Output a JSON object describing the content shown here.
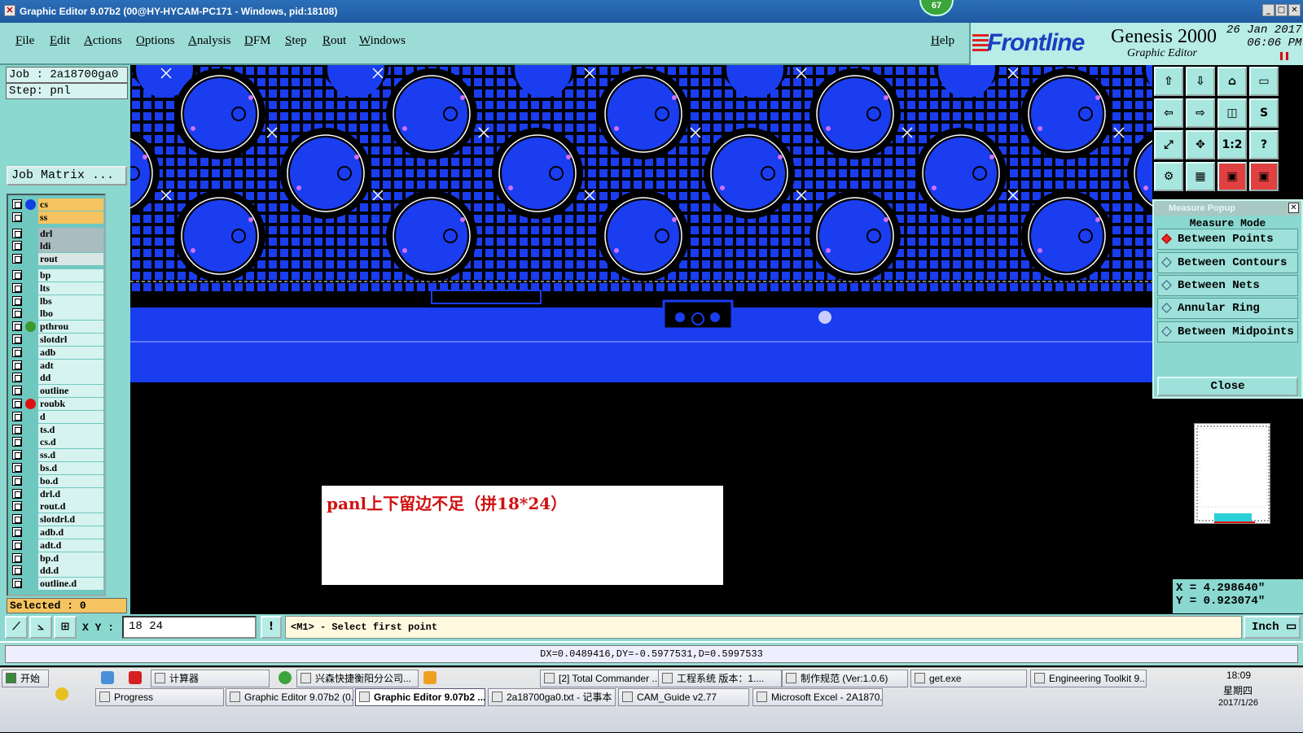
{
  "window": {
    "title": "Graphic Editor 9.07b2 (00@HY-HYCAM-PC171 - Windows, pid:18108)",
    "badge": "67",
    "minimize": "_",
    "maximize": "□",
    "close": "✕"
  },
  "menu": [
    "File",
    "Edit",
    "Actions",
    "Options",
    "Analysis",
    "DFM",
    "Step",
    "Rout",
    "Windows"
  ],
  "help": "Help",
  "brand": {
    "logo": "Frontline",
    "product": "Genesis 2000",
    "subtitle": "Graphic Editor",
    "date": "26 Jan 2017",
    "time": "06:06 PM"
  },
  "left": {
    "job": "Job : 2a18700ga0",
    "step": "Step: pnl",
    "job_matrix": "Job Matrix ...",
    "selected": "Selected : 0"
  },
  "layers": [
    {
      "name": "cs",
      "bg": "#f5c460",
      "dot": "#1040e0"
    },
    {
      "name": "ss",
      "bg": "#f5c460",
      "dot": ""
    },
    {
      "name": "drl",
      "bg": "#a9bcc0",
      "dot": ""
    },
    {
      "name": "ldi",
      "bg": "#a9bcc0",
      "dot": ""
    },
    {
      "name": "rout",
      "bg": "#d8e6e4",
      "dot": ""
    },
    {
      "name": "bp",
      "bg": "#d6f3ef",
      "dot": ""
    },
    {
      "name": "lts",
      "bg": "#d6f3ef",
      "dot": ""
    },
    {
      "name": "lbs",
      "bg": "#d6f3ef",
      "dot": ""
    },
    {
      "name": "lbo",
      "bg": "#d6f3ef",
      "dot": ""
    },
    {
      "name": "pthrou",
      "bg": "#d6f3ef",
      "dot": "#3a9a2a"
    },
    {
      "name": "slotdrl",
      "bg": "#d6f3ef",
      "dot": ""
    },
    {
      "name": "adb",
      "bg": "#d6f3ef",
      "dot": ""
    },
    {
      "name": "adt",
      "bg": "#d6f3ef",
      "dot": ""
    },
    {
      "name": "dd",
      "bg": "#d6f3ef",
      "dot": ""
    },
    {
      "name": "outline",
      "bg": "#d6f3ef",
      "dot": ""
    },
    {
      "name": "roubk",
      "bg": "#d6f3ef",
      "dot": "#e01010"
    },
    {
      "name": "d",
      "bg": "#d6f3ef",
      "dot": ""
    },
    {
      "name": "ts.d",
      "bg": "#d6f3ef",
      "dot": ""
    },
    {
      "name": "cs.d",
      "bg": "#d6f3ef",
      "dot": ""
    },
    {
      "name": "ss.d",
      "bg": "#d6f3ef",
      "dot": ""
    },
    {
      "name": "bs.d",
      "bg": "#d6f3ef",
      "dot": ""
    },
    {
      "name": "bo.d",
      "bg": "#d6f3ef",
      "dot": ""
    },
    {
      "name": "drl.d",
      "bg": "#d6f3ef",
      "dot": ""
    },
    {
      "name": "rout.d",
      "bg": "#d6f3ef",
      "dot": ""
    },
    {
      "name": "slotdrl.d",
      "bg": "#d6f3ef",
      "dot": ""
    },
    {
      "name": "adb.d",
      "bg": "#d6f3ef",
      "dot": ""
    },
    {
      "name": "adt.d",
      "bg": "#d6f3ef",
      "dot": ""
    },
    {
      "name": "bp.d",
      "bg": "#d6f3ef",
      "dot": ""
    },
    {
      "name": "dd.d",
      "bg": "#d6f3ef",
      "dot": ""
    },
    {
      "name": "outline.d",
      "bg": "#d6f3ef",
      "dot": ""
    }
  ],
  "toolbar_icons": [
    "move-up-icon",
    "move-down-icon",
    "home-icon",
    "frame-icon",
    "back-icon",
    "forward-icon",
    "window-icon",
    "snap-icon",
    "fit-icon",
    "center-icon",
    "scale-icon",
    "help-icon",
    "settings-icon",
    "grid-icon",
    "layers-red-icon",
    "layers-red2-icon"
  ],
  "toolbar_glyphs": [
    "⇧",
    "⇩",
    "⌂",
    "▭",
    "⇦",
    "⇨",
    "◫",
    "S",
    "⤢",
    "✥",
    "1:2",
    "?",
    "⚙",
    "▦",
    "▣",
    "▣"
  ],
  "measure": {
    "title": "Measure Popup",
    "close_x": "✕",
    "mode_label": "Measure Mode",
    "options": [
      "Between Points",
      "Between Contours",
      "Between Nets",
      "Annular Ring",
      "Between Midpoints"
    ],
    "selected": "Between Points",
    "close": "Close"
  },
  "coords": {
    "x": "X = 4.298640\"",
    "y": "Y = 0.923074\""
  },
  "bottom": {
    "xy_label": "X Y :",
    "xy_value": "18 24",
    "info_btn": "!",
    "prompt": "<M1> - Select first point",
    "unit": "Inch ▭"
  },
  "bottom_icons": [
    "snap-edge-icon",
    "snap-angle-icon",
    "snap-grid-icon"
  ],
  "bottom_glyphs": [
    "⟋",
    "⦣",
    "⊞"
  ],
  "status": "DX=0.0489416,DY=-0.5977531,D=0.5997533",
  "note": "panl上下留边不足（拼18*24）",
  "taskbar": {
    "start": "开始",
    "row1": [
      "计算器",
      "兴森快捷衡阳分公司...",
      "[2] Total Commander ...",
      "工程系统  版本：1....",
      "制作规范 (Ver:1.0.6)",
      "get.exe",
      "Engineering Toolkit 9...."
    ],
    "row2": [
      "Progress",
      "Graphic Editor 9.07b2 (0...",
      "Graphic Editor 9.07b2 ...",
      "2a18700ga0.txt - 记事本",
      "CAM_Guide v2.77",
      "Microsoft Excel - 2A1870..."
    ],
    "clock": "18:09",
    "weekday": "星期四",
    "date": "2017/1/26"
  }
}
